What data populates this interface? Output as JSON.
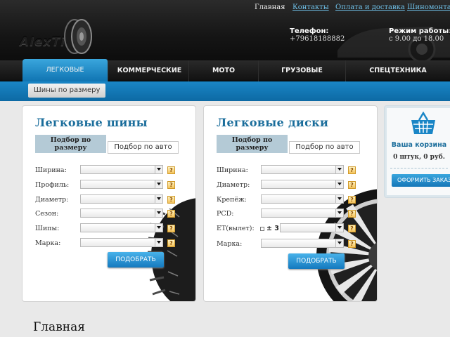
{
  "topnav": {
    "links": [
      "Главная",
      "Контакты",
      "Оплата и доставка",
      "Шиномонтаж"
    ]
  },
  "header": {
    "logo": "AlexTires",
    "phone_label": "Телефон:",
    "phone_value": "+79618188882",
    "hours_label": "Режим работы:",
    "hours_value": "с 9.00 до 18.00"
  },
  "categories": [
    "ЛЕГКОВЫЕ",
    "КОММЕРЧЕСКИЕ",
    "МОТО",
    "ГРУЗОВЫЕ",
    "СПЕЦТЕХНИКА"
  ],
  "subnav": {
    "button": "Шины по размеру"
  },
  "tires": {
    "title": "Легковые шины",
    "tab_size": "Подбор по размеру",
    "tab_auto": "Подбор по авто",
    "fields": [
      "Ширина:",
      "Профиль:",
      "Диаметр:",
      "Сезон:",
      "Шипы:",
      "Марка:"
    ],
    "help": "?",
    "button": "ПОДОБРАТЬ"
  },
  "discs": {
    "title": "Легковые диски",
    "tab_size": "Подбор по размеру",
    "tab_auto": "Подбор по авто",
    "fields": [
      "Ширина:",
      "Диаметр:",
      "Крепёж:",
      "PCD:",
      "ET(вылет):",
      "Марка:"
    ],
    "et_tolerance": "± 3",
    "help": "?",
    "button": "ПОДОБРАТЬ"
  },
  "cart": {
    "title": "Ваша корзина",
    "count": "0 штук, 0 руб.",
    "button": "ОФОРМИТЬ ЗАКАЗ"
  },
  "page": {
    "title": "Главная"
  },
  "colors": {
    "accent": "#1a86c6",
    "heading": "#1a6d9b",
    "header_bg": "#151515"
  }
}
